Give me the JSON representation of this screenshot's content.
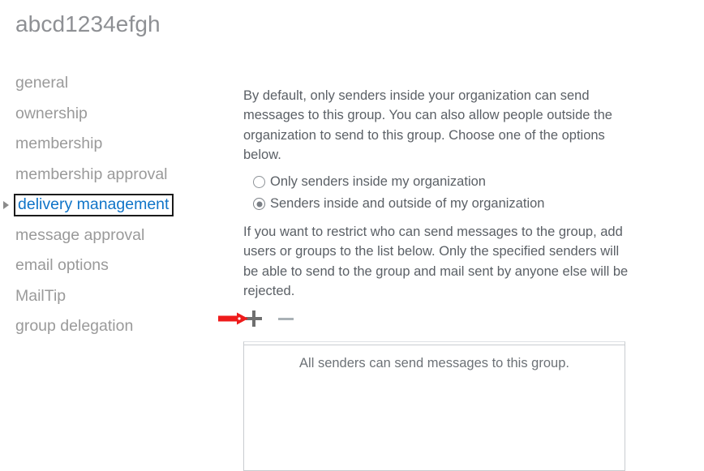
{
  "page": {
    "title": "abcd1234efgh"
  },
  "sidebar": {
    "items": [
      {
        "label": "general",
        "selected": false
      },
      {
        "label": "ownership",
        "selected": false
      },
      {
        "label": "membership",
        "selected": false
      },
      {
        "label": "membership approval",
        "selected": false
      },
      {
        "label": "delivery management",
        "selected": true
      },
      {
        "label": "message approval",
        "selected": false
      },
      {
        "label": "email options",
        "selected": false
      },
      {
        "label": "MailTip",
        "selected": false
      },
      {
        "label": "group delegation",
        "selected": false
      }
    ]
  },
  "main": {
    "intro_text": "By default, only senders inside your organization can send messages to this group. You can also allow people outside the organization to send to this group. Choose one of the options below.",
    "radio_options": [
      {
        "label": "Only senders inside my organization",
        "checked": false
      },
      {
        "label": "Senders inside and outside of my organization",
        "checked": true
      }
    ],
    "restrict_text": "If you want to restrict who can send messages to the group, add users or groups to the list below. Only the specified senders will be able to send to the group and mail sent by anyone else will be rejected.",
    "toolbar": {
      "add_icon": "plus-icon",
      "remove_icon": "minus-icon"
    },
    "listbox": {
      "empty_message": "All senders can send messages to this group.",
      "items": []
    }
  },
  "annotation": {
    "arrow_icon": "red-right-arrow-icon",
    "color": "#ee1b1b"
  },
  "colors": {
    "accent_blue": "#0f74c8",
    "nav_text": "#9a9a9a",
    "body_text": "#5b6066",
    "title_text": "#8e9094",
    "border": "#c9ccd0",
    "annotation_red": "#ee1b1b"
  }
}
